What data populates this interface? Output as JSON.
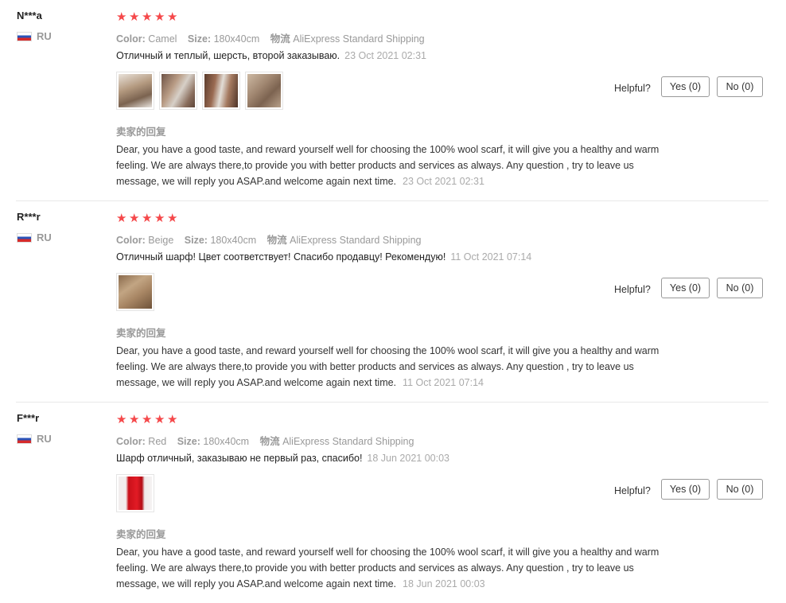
{
  "labels": {
    "color": "Color:",
    "size": "Size:",
    "shipping": "物流",
    "helpful": "Helpful?",
    "reply_title": "卖家的回复"
  },
  "colors": {
    "star": "#f5484a",
    "muted": "#999999"
  },
  "reviews": [
    {
      "user": "N***a",
      "country": "RU",
      "rating": 5,
      "color": "Camel",
      "size": "180x40cm",
      "shipping": "AliExpress Standard Shipping",
      "text": "Отличный и теплый, шерсть, второй заказываю.",
      "date": "23 Oct 2021 02:31",
      "yes": "Yes (0)",
      "no": "No (0)",
      "reply": "Dear, you have a good taste, and reward yourself well for choosing the 100% wool scarf, it will give you a healthy and warm feeling. We are always there,to provide you with better products and services as always. Any question , try to leave us message, we will reply you ASAP.and welcome again next time.",
      "reply_date": "23 Oct 2021 02:31"
    },
    {
      "user": "R***r",
      "country": "RU",
      "rating": 5,
      "color": "Beige",
      "size": "180x40cm",
      "shipping": "AliExpress Standard Shipping",
      "text": "Отличный шарф! Цвет соответствует! Спасибо продавцу! Рекомендую!",
      "date": "11 Oct 2021 07:14",
      "yes": "Yes (0)",
      "no": "No (0)",
      "reply": "Dear, you have a good taste, and reward yourself well for choosing the 100% wool scarf, it will give you a healthy and warm feeling. We are always there,to provide you with better products and services as always. Any question , try to leave us message, we will reply you ASAP.and welcome again next time.",
      "reply_date": "11 Oct 2021 07:14"
    },
    {
      "user": "F***r",
      "country": "RU",
      "rating": 5,
      "color": "Red",
      "size": "180x40cm",
      "shipping": "AliExpress Standard Shipping",
      "text": "Шарф отличный, заказываю не первый раз, спасибо!",
      "date": "18 Jun 2021 00:03",
      "yes": "Yes (0)",
      "no": "No (0)",
      "reply": "Dear, you have a good taste, and reward yourself well for choosing the 100% wool scarf, it will give you a healthy and warm feeling. We are always there,to provide you with better products and services as always. Any question , try to leave us message, we will reply you ASAP.and welcome again next time.",
      "reply_date": "18 Jun 2021 00:03"
    }
  ]
}
